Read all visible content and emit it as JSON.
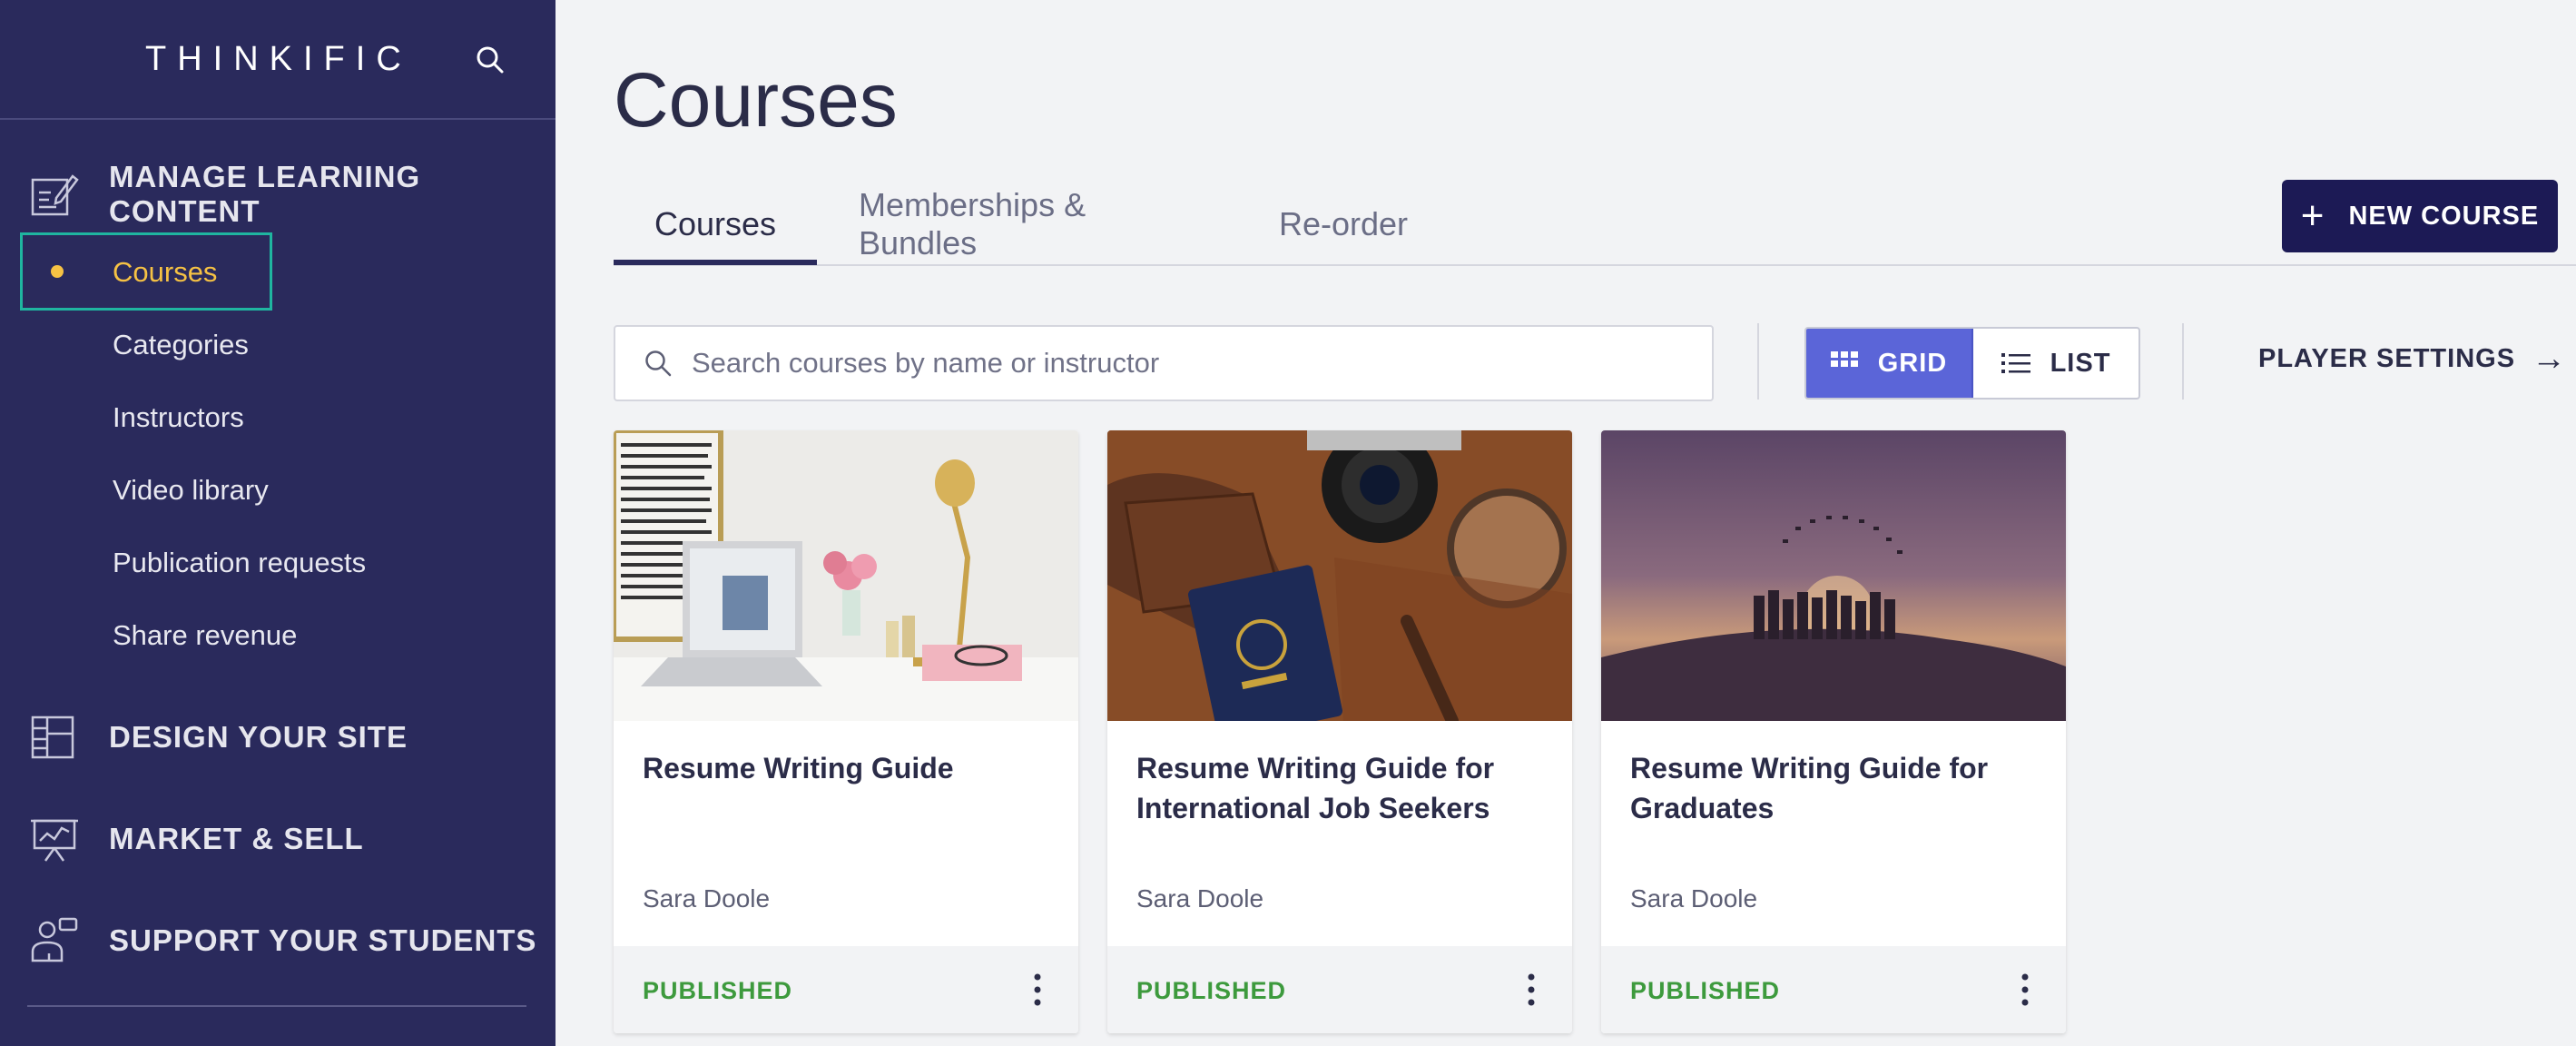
{
  "sidebar": {
    "brand": "THINKIFIC",
    "sections": [
      {
        "label": "MANAGE LEARNING CONTENT",
        "icon": "edit-content-icon"
      },
      {
        "label": "DESIGN YOUR SITE",
        "icon": "layout-icon"
      },
      {
        "label": "MARKET & SELL",
        "icon": "presentation-chart-icon"
      },
      {
        "label": "SUPPORT YOUR STUDENTS",
        "icon": "students-icon"
      }
    ],
    "items": [
      {
        "label": "Courses",
        "active": true
      },
      {
        "label": "Categories"
      },
      {
        "label": "Instructors"
      },
      {
        "label": "Video library"
      },
      {
        "label": "Publication requests"
      },
      {
        "label": "Share revenue"
      }
    ]
  },
  "main": {
    "title": "Courses",
    "tabs": [
      {
        "label": "Courses",
        "active": true
      },
      {
        "label": "Memberships & Bundles"
      },
      {
        "label": "Re-order"
      }
    ],
    "new_course_label": "NEW COURSE",
    "search_placeholder": "Search courses by name or instructor",
    "view": {
      "grid_label": "GRID",
      "list_label": "LIST",
      "selected": "GRID"
    },
    "player_settings_label": "PLAYER SETTINGS",
    "courses": [
      {
        "title": "Resume Writing Guide",
        "instructor": "Sara Doole",
        "status": "PUBLISHED"
      },
      {
        "title": "Resume Writing Guide for International Job Seekers",
        "instructor": "Sara Doole",
        "status": "PUBLISHED"
      },
      {
        "title": "Resume Writing Guide for Graduates",
        "instructor": "Sara Doole",
        "status": "PUBLISHED"
      }
    ]
  },
  "colors": {
    "sidebar_bg": "#2a2a5c",
    "active_highlight": "#f6c244",
    "active_border": "#1fb5a0",
    "primary_button": "#1c1a55",
    "grid_toggle": "#5b65d8",
    "published": "#3d9a3d"
  }
}
